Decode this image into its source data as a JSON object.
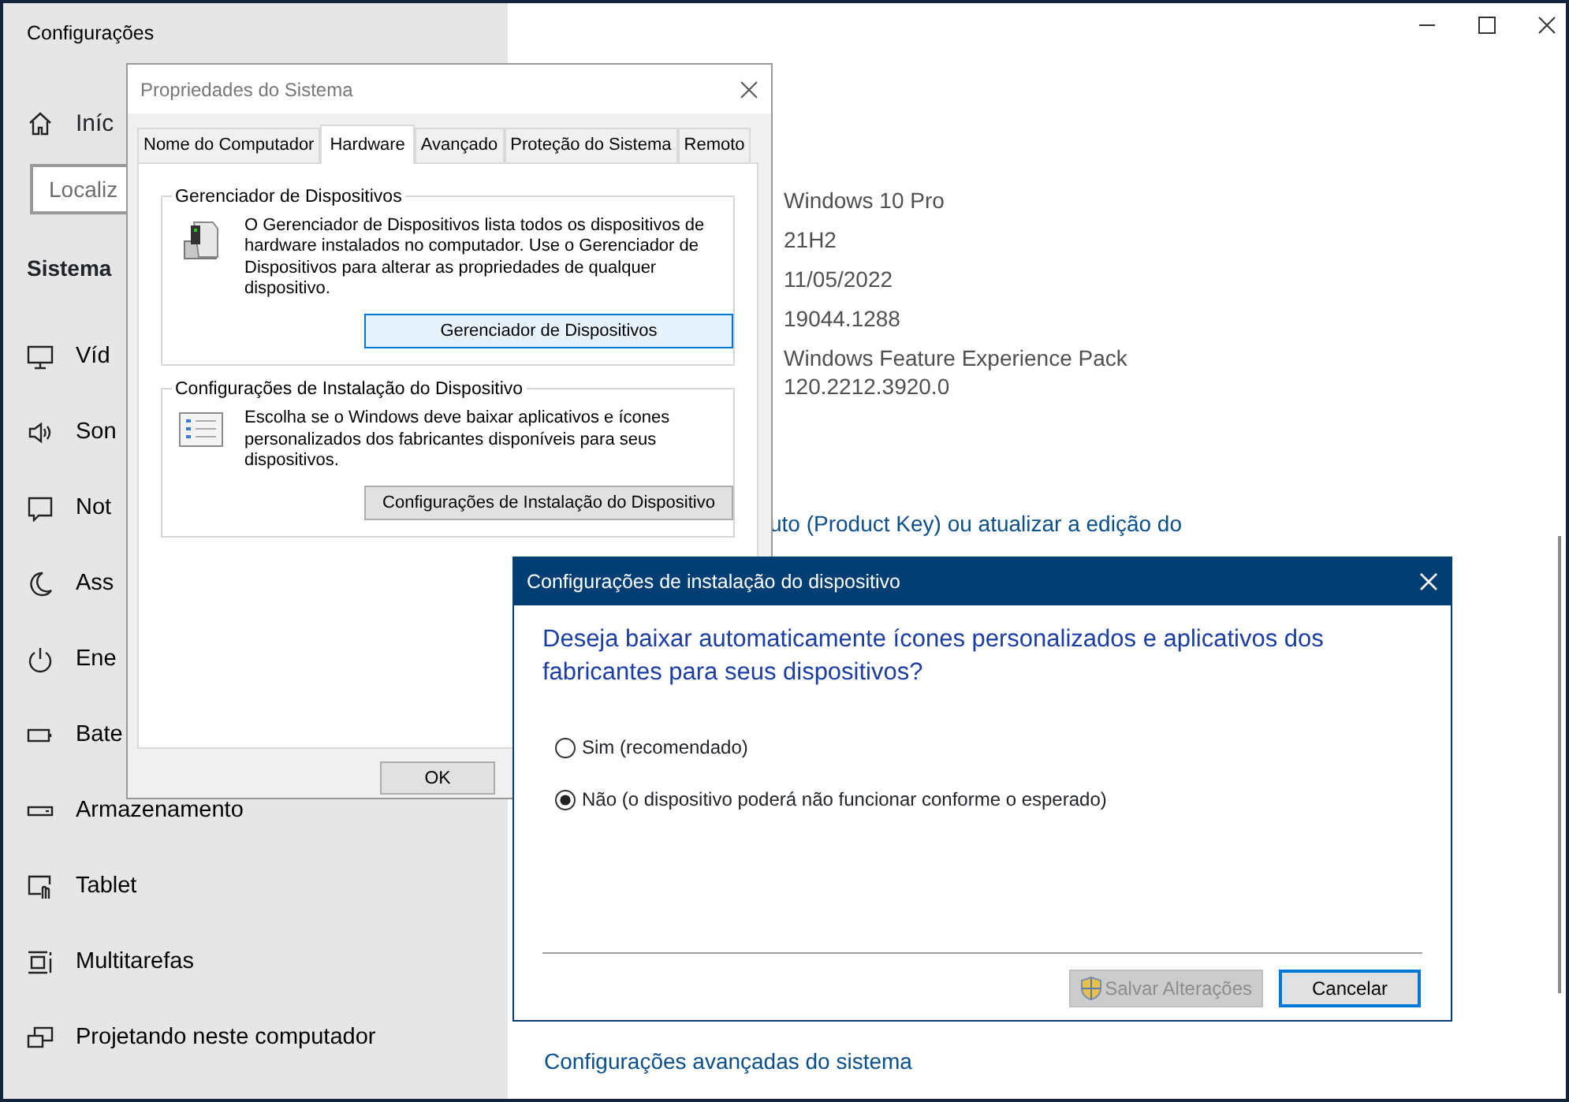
{
  "settings_window": {
    "title": "Configurações",
    "sidebar": {
      "home": "Iníc",
      "search": {
        "placeholder": "Localiz"
      },
      "section": "Sistema",
      "items": [
        {
          "label": "Víd",
          "kind": "display"
        },
        {
          "label": "Son",
          "kind": "sound"
        },
        {
          "label": "Not",
          "kind": "notifications"
        },
        {
          "label": "Ass",
          "kind": "focus"
        },
        {
          "label": "Ene",
          "kind": "power"
        },
        {
          "label": "Bate",
          "kind": "battery"
        },
        {
          "label": "Armazenamento",
          "kind": "storage"
        },
        {
          "label": "Tablet",
          "kind": "tablet"
        },
        {
          "label": "Multitarefas",
          "kind": "multitasking"
        },
        {
          "label": "Projetando neste computador",
          "kind": "projecting"
        }
      ]
    },
    "details": [
      "Windows 10 Pro",
      "21H2",
      "11/05/2022",
      "19044.1288",
      "Windows Feature Experience Pack 120.2212.3920.0"
    ],
    "product_key_link": "uto (Product Key) ou atualizar a edição do",
    "advanced_link": "Configurações avançadas do sistema"
  },
  "system_properties": {
    "title": "Propriedades do Sistema",
    "tabs": [
      {
        "label": "Nome do Computador",
        "selected": false
      },
      {
        "label": "Hardware",
        "selected": true
      },
      {
        "label": "Avançado",
        "selected": false
      },
      {
        "label": "Proteção do Sistema",
        "selected": false
      },
      {
        "label": "Remoto",
        "selected": false
      }
    ],
    "groups": [
      {
        "title": "Gerenciador de Dispositivos",
        "kind": "device-manager",
        "text": "O Gerenciador de Dispositivos lista todos os dispositivos de hardware instalados no computador. Use o Gerenciador de Dispositivos para alterar as propriedades de qualquer dispositivo.",
        "button": {
          "label": "Gerenciador de Dispositivos",
          "focused": true
        }
      },
      {
        "title": "Configurações de Instalação do Dispositivo",
        "kind": "installation",
        "text": "Escolha se o Windows deve baixar aplicativos e ícones personalizados dos fabricantes disponíveis para seus dispositivos.",
        "button": {
          "label": "Configurações de Instalação do Dispositivo",
          "focused": false
        }
      }
    ],
    "buttons": [
      "OK"
    ]
  },
  "install_dialog": {
    "title": "Configurações de instalação do dispositivo",
    "question": "Deseja baixar automaticamente ícones personalizados e aplicativos dos fabricantes para seus dispositivos?",
    "options": [
      {
        "label": "Sim (recomendado)",
        "selected": false
      },
      {
        "label": "Não (o dispositivo poderá não funcionar conforme o esperado)",
        "selected": true
      }
    ],
    "buttons": [
      {
        "label": "Salvar Alterações",
        "kind": "elevated",
        "disabled": true,
        "focused": false
      },
      {
        "label": "Cancelar",
        "kind": "normal",
        "disabled": false,
        "focused": true
      }
    ]
  }
}
